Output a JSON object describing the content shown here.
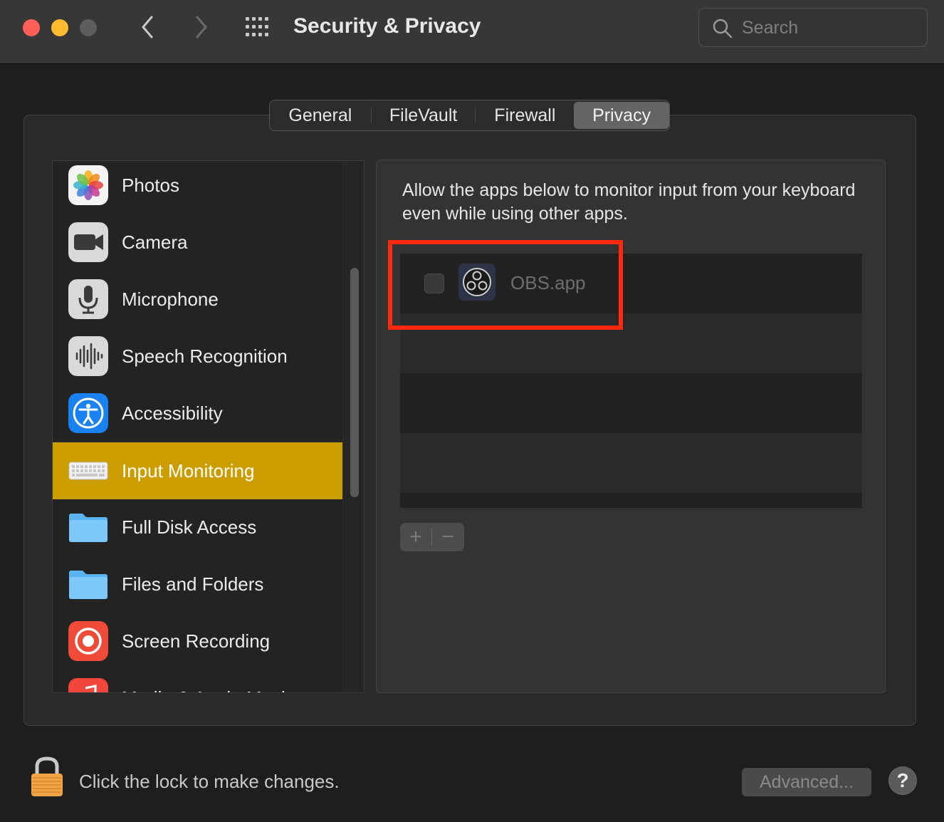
{
  "window": {
    "title": "Security & Privacy",
    "search_placeholder": "Search"
  },
  "tabs": [
    {
      "label": "General"
    },
    {
      "label": "FileVault"
    },
    {
      "label": "Firewall"
    },
    {
      "label": "Privacy",
      "selected": true
    }
  ],
  "categories": [
    {
      "label": "Photos",
      "icon": "photos-icon"
    },
    {
      "label": "Camera",
      "icon": "camera-icon"
    },
    {
      "label": "Microphone",
      "icon": "microphone-icon"
    },
    {
      "label": "Speech Recognition",
      "icon": "speech-recognition-icon"
    },
    {
      "label": "Accessibility",
      "icon": "accessibility-icon"
    },
    {
      "label": "Input Monitoring",
      "icon": "keyboard-icon",
      "selected": true
    },
    {
      "label": "Full Disk Access",
      "icon": "folder-icon"
    },
    {
      "label": "Files and Folders",
      "icon": "folder-icon"
    },
    {
      "label": "Screen Recording",
      "icon": "screen-recording-icon"
    },
    {
      "label": "Media & Apple Music",
      "icon": "music-icon"
    }
  ],
  "detail": {
    "description": "Allow the apps below to monitor input from your keyboard even while using other apps.",
    "apps": [
      {
        "name": "OBS.app",
        "checked": false,
        "icon": "obs-icon"
      }
    ],
    "add_label": "+",
    "remove_label": "−"
  },
  "footer": {
    "lock_text": "Click the lock to make changes.",
    "advanced_label": "Advanced...",
    "help_label": "?"
  },
  "colors": {
    "selection": "#cc9d00",
    "highlight": "#ff2a0e"
  }
}
